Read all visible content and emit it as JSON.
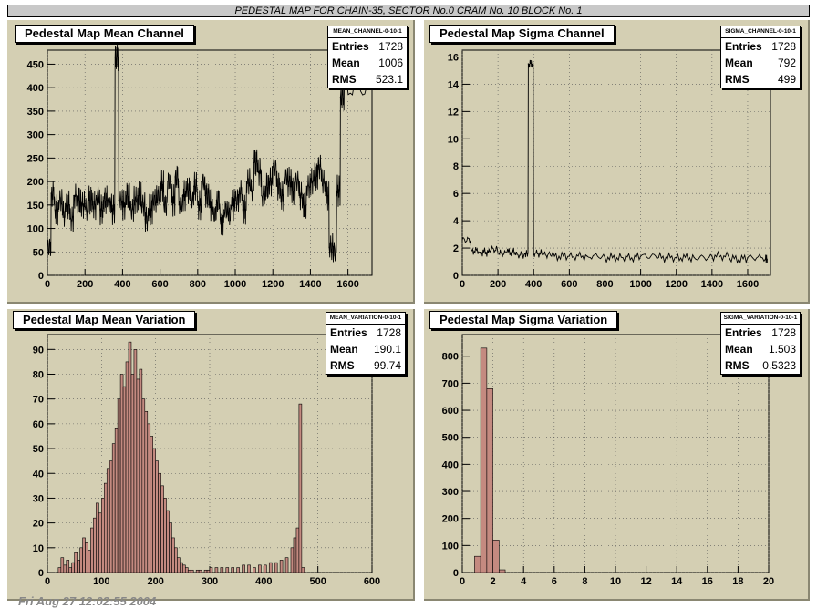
{
  "banner": "PEDESTAL MAP FOR CHAIN-35, SECTOR No.0 CRAM No. 10 BLOCK No. 1",
  "footer": "Fri Aug 27 12:02:55 2004",
  "colors": {
    "pad_bg": "#d4cfb3",
    "hist_fill": "#c48a80",
    "line": "#000000"
  },
  "panels": [
    {
      "id": "mean-channel",
      "title": "Pedestal Map Mean Channel",
      "stats_name": "MEAN_CHANNEL-0-10-1",
      "stats": [
        {
          "label": "Entries",
          "value": "1728"
        },
        {
          "label": "Mean",
          "value": "1006"
        },
        {
          "label": "RMS",
          "value": "523.1"
        }
      ]
    },
    {
      "id": "sigma-channel",
      "title": "Pedestal Map Sigma Channel",
      "stats_name": "SIGMA_CHANNEL-0-10-1",
      "stats": [
        {
          "label": "Entries",
          "value": "1728"
        },
        {
          "label": "Mean",
          "value": "792"
        },
        {
          "label": "RMS",
          "value": "499"
        }
      ]
    },
    {
      "id": "mean-variation",
      "title": "Pedestal Map Mean Variation",
      "stats_name": "MEAN_VARIATION-0-10-1",
      "stats": [
        {
          "label": "Entries",
          "value": "1728"
        },
        {
          "label": "Mean",
          "value": "190.1"
        },
        {
          "label": "RMS",
          "value": "99.74"
        }
      ]
    },
    {
      "id": "sigma-variation",
      "title": "Pedestal Map Sigma Variation",
      "stats_name": "SIGMA_VARIATION-0-10-1",
      "stats": [
        {
          "label": "Entries",
          "value": "1728"
        },
        {
          "label": "Mean",
          "value": "1.503"
        },
        {
          "label": "RMS",
          "value": "0.5323"
        }
      ]
    }
  ],
  "chart_data": [
    {
      "type": "line",
      "title": "Pedestal Map Mean Channel",
      "xlim": [
        0,
        1728
      ],
      "ylim": [
        0,
        480
      ],
      "grid": true,
      "xticks": [
        0,
        200,
        400,
        600,
        800,
        1000,
        1200,
        1400,
        1600
      ],
      "yticks": [
        0,
        50,
        100,
        150,
        200,
        250,
        300,
        350,
        400,
        450
      ],
      "x": [
        0,
        20,
        40,
        60,
        80,
        100,
        120,
        140,
        160,
        180,
        200,
        220,
        240,
        260,
        280,
        300,
        320,
        340,
        360,
        380,
        400,
        420,
        440,
        460,
        480,
        500,
        520,
        540,
        560,
        580,
        600,
        620,
        640,
        660,
        680,
        700,
        720,
        740,
        760,
        780,
        800,
        820,
        840,
        860,
        880,
        900,
        920,
        940,
        960,
        980,
        1000,
        1020,
        1040,
        1060,
        1080,
        1100,
        1120,
        1140,
        1160,
        1180,
        1200,
        1220,
        1240,
        1260,
        1280,
        1300,
        1320,
        1340,
        1360,
        1380,
        1400,
        1420,
        1440,
        1460,
        1480,
        1500,
        1520,
        1540,
        1560,
        1580
      ],
      "y": [
        60,
        175,
        140,
        160,
        130,
        150,
        120,
        170,
        160,
        150,
        140,
        160,
        150,
        170,
        140,
        160,
        150,
        140,
        465,
        160,
        150,
        170,
        140,
        160,
        170,
        150,
        120,
        140,
        160,
        170,
        190,
        150,
        200,
        160,
        210,
        150,
        170,
        180,
        160,
        190,
        150,
        200,
        170,
        150,
        130,
        160,
        120,
        140,
        130,
        150,
        160,
        180,
        140,
        200,
        180,
        240,
        220,
        170,
        190,
        200,
        230,
        190,
        170,
        210,
        200,
        180,
        200,
        170,
        150,
        190,
        200,
        210,
        230,
        200,
        170,
        60,
        50,
        180,
        380,
        400
      ],
      "series": [
        {
          "values": "y"
        }
      ]
    },
    {
      "type": "line",
      "title": "Pedestal Map Sigma Channel",
      "xlim": [
        0,
        1728
      ],
      "ylim": [
        0,
        16.5
      ],
      "grid": true,
      "xticks": [
        0,
        200,
        400,
        600,
        800,
        1000,
        1200,
        1400,
        1600
      ],
      "yticks": [
        0,
        2,
        4,
        6,
        8,
        10,
        12,
        14,
        16
      ],
      "x": [
        0,
        50,
        100,
        150,
        200,
        250,
        300,
        350,
        370,
        400,
        450,
        500,
        600,
        700,
        800,
        900,
        1000,
        1100,
        1200,
        1300,
        1400,
        1500,
        1600,
        1700
      ],
      "y": [
        2.6,
        1.8,
        1.7,
        1.9,
        1.6,
        1.7,
        1.5,
        1.6,
        15.5,
        1.6,
        1.5,
        1.4,
        1.4,
        1.4,
        1.3,
        1.3,
        1.4,
        1.3,
        1.3,
        1.3,
        1.4,
        1.2,
        1.3,
        1.2
      ]
    },
    {
      "type": "bar",
      "title": "Pedestal Map Mean Variation",
      "xlim": [
        0,
        600
      ],
      "ylim": [
        0,
        96
      ],
      "grid": true,
      "xticks": [
        0,
        100,
        200,
        300,
        400,
        500,
        600
      ],
      "yticks": [
        0,
        10,
        20,
        30,
        40,
        50,
        60,
        70,
        80,
        90
      ],
      "bin_width": 5,
      "bin_start": [
        20,
        25,
        30,
        35,
        40,
        45,
        50,
        55,
        60,
        65,
        70,
        75,
        80,
        85,
        90,
        95,
        100,
        105,
        110,
        115,
        120,
        125,
        130,
        135,
        140,
        145,
        150,
        155,
        160,
        165,
        170,
        175,
        180,
        185,
        190,
        195,
        200,
        205,
        210,
        215,
        220,
        225,
        230,
        235,
        240,
        245,
        250,
        255,
        260,
        265,
        270,
        275,
        280,
        285,
        290,
        295,
        300,
        310,
        320,
        330,
        340,
        350,
        360,
        370,
        380,
        390,
        400,
        410,
        420,
        430,
        440,
        450,
        455,
        460,
        465,
        470
      ],
      "values": [
        2,
        6,
        3,
        5,
        2,
        4,
        8,
        5,
        10,
        14,
        12,
        9,
        18,
        22,
        28,
        24,
        30,
        36,
        42,
        45,
        52,
        58,
        70,
        80,
        75,
        85,
        93,
        80,
        90,
        78,
        82,
        70,
        65,
        60,
        55,
        50,
        45,
        40,
        35,
        30,
        25,
        20,
        14,
        10,
        6,
        4,
        3,
        2,
        1,
        1,
        0,
        1,
        1,
        0,
        1,
        1,
        2,
        2,
        2,
        2,
        2,
        2,
        3,
        3,
        2,
        3,
        3,
        4,
        4,
        5,
        6,
        10,
        14,
        18,
        68,
        2
      ]
    },
    {
      "type": "bar",
      "title": "Pedestal Map Sigma Variation",
      "xlim": [
        0,
        20
      ],
      "ylim": [
        0,
        880
      ],
      "grid": true,
      "xticks": [
        0,
        2,
        4,
        6,
        8,
        10,
        12,
        14,
        16,
        18,
        20
      ],
      "yticks": [
        0,
        100,
        200,
        300,
        400,
        500,
        600,
        700,
        800
      ],
      "bin_width": 0.4,
      "bin_start": [
        0.8,
        1.2,
        1.6,
        2.0,
        2.4
      ],
      "values": [
        60,
        830,
        680,
        120,
        10
      ]
    }
  ]
}
